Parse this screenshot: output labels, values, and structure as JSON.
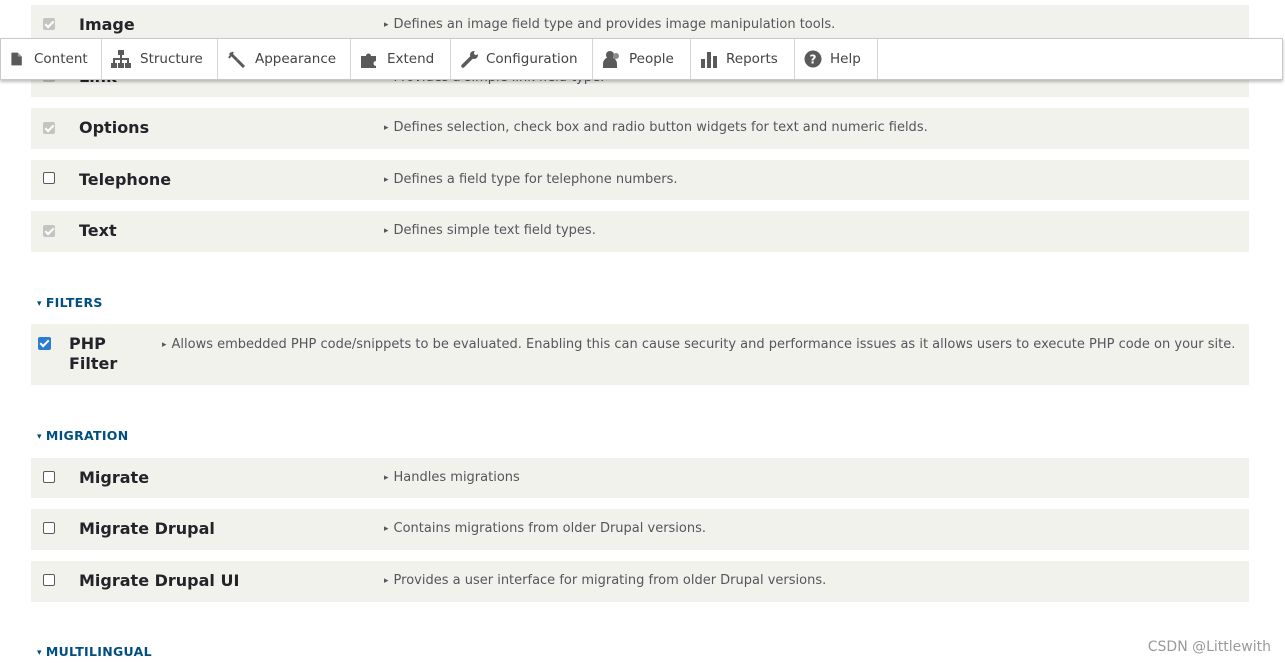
{
  "toolbar": {
    "items": [
      {
        "label": "Content",
        "icon": "content-icon"
      },
      {
        "label": "Structure",
        "icon": "structure-icon"
      },
      {
        "label": "Appearance",
        "icon": "appearance-icon"
      },
      {
        "label": "Extend",
        "icon": "extend-icon"
      },
      {
        "label": "Configuration",
        "icon": "configuration-icon"
      },
      {
        "label": "People",
        "icon": "people-icon"
      },
      {
        "label": "Reports",
        "icon": "reports-icon"
      },
      {
        "label": "Help",
        "icon": "help-icon"
      }
    ]
  },
  "field_types": {
    "modules": [
      {
        "name": "Image",
        "description": "Defines an image field type and provides image manipulation tools.",
        "state": "enabled-locked"
      },
      {
        "name": "Link",
        "description": "Provides a simple link field type.",
        "state": "enabled-locked"
      },
      {
        "name": "Options",
        "description": "Defines selection, check box and radio button widgets for text and numeric fields.",
        "state": "enabled-locked"
      },
      {
        "name": "Telephone",
        "description": "Defines a field type for telephone numbers.",
        "state": "unchecked"
      },
      {
        "name": "Text",
        "description": "Defines simple text field types.",
        "state": "enabled-locked"
      }
    ]
  },
  "filters": {
    "title": "FILTERS",
    "modules": [
      {
        "name_line1": "PHP",
        "name_line2": "Filter",
        "description": "Allows embedded PHP code/snippets to be evaluated. Enabling this can cause security and performance issues as it allows users to execute PHP code on your site.",
        "state": "checked"
      }
    ]
  },
  "migration": {
    "title": "MIGRATION",
    "modules": [
      {
        "name": "Migrate",
        "description": "Handles migrations",
        "state": "unchecked"
      },
      {
        "name": "Migrate Drupal",
        "description": "Contains migrations from older Drupal versions.",
        "state": "unchecked"
      },
      {
        "name": "Migrate Drupal UI",
        "description": "Provides a user interface for migrating from older Drupal versions.",
        "state": "unchecked"
      }
    ]
  },
  "multilingual": {
    "title": "MULTILINGUAL"
  },
  "watermark": "CSDN @Littlewith",
  "colors": {
    "section_title": "#004f80",
    "row_bg": "#f2f2ed",
    "checkbox_checked": "#2b7bd0"
  }
}
